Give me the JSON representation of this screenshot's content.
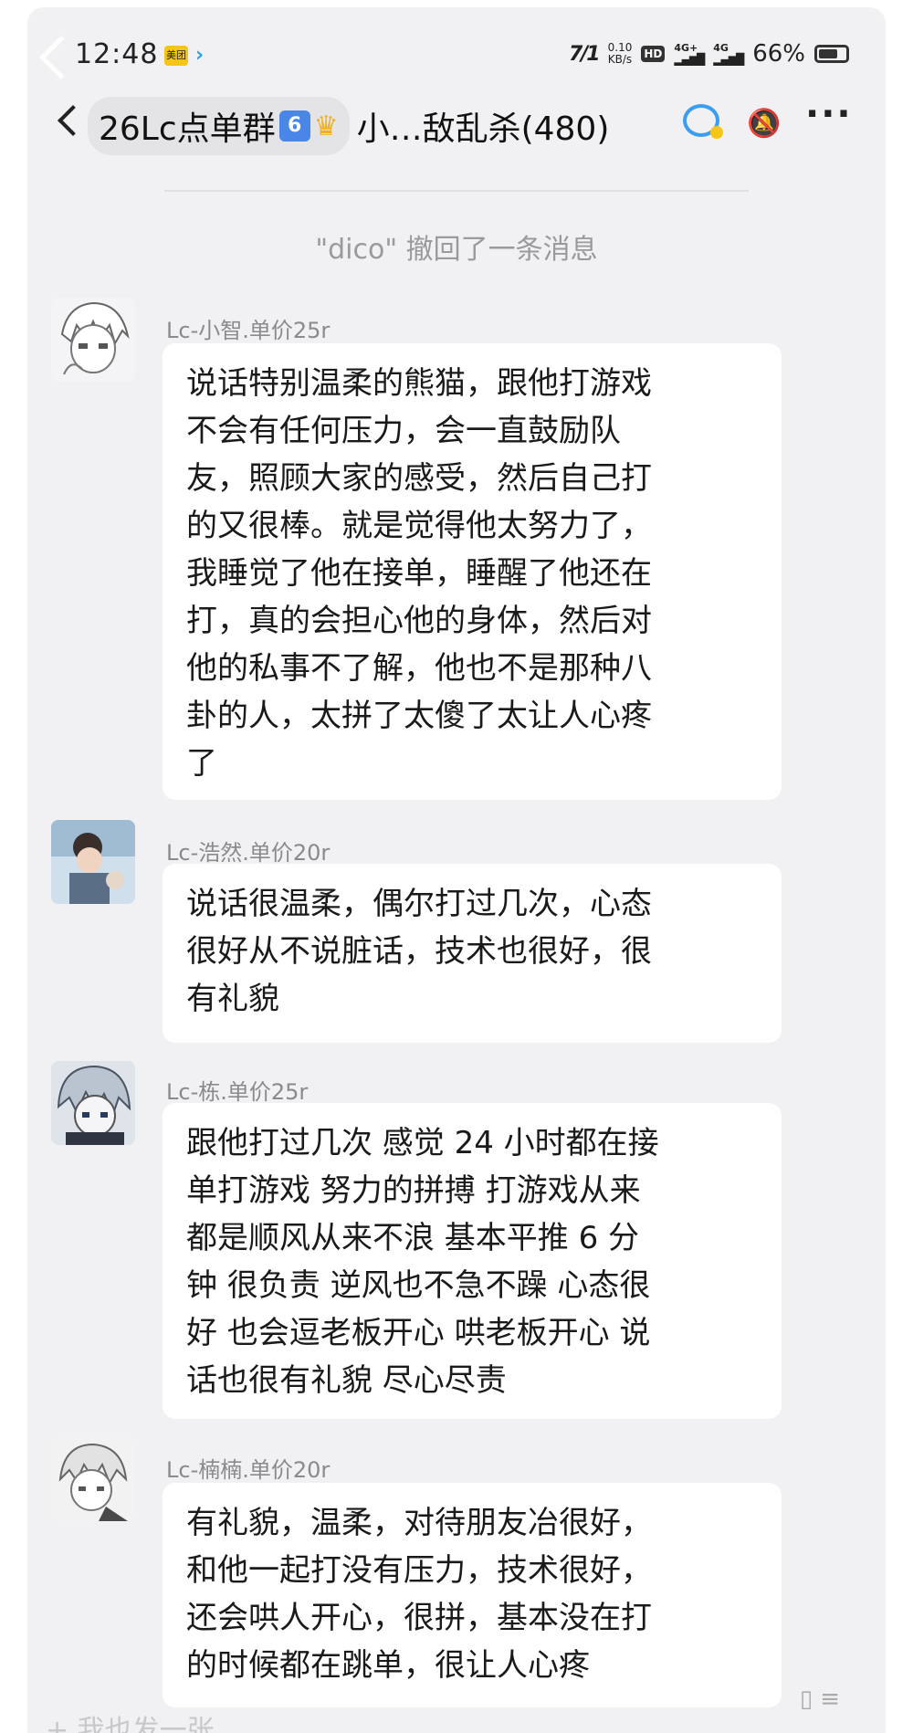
{
  "status_bar": {
    "time": "12:48",
    "app1_label": "美团",
    "network": "7/1",
    "speed_value": "0.10",
    "speed_unit": "KB/s",
    "hd_label": "HD",
    "signal1": "4G+",
    "signal2": "4G",
    "battery": "66%"
  },
  "header": {
    "group_name": "26Lc点单群",
    "group_badge": "6",
    "group_rest": "小…敌乱杀(480)"
  },
  "recall_notice": "\"dico\" 撤回了一条消息",
  "messages": [
    {
      "sender": "Lc-小智.单价25r",
      "lines": [
        "说话特别温柔的熊猫，跟他打游戏",
        "不会有任何压力，会一直鼓励队",
        "友，照顾大家的感受，然后自己打",
        "的又很棒。就是觉得他太努力了，",
        "我睡觉了他在接单，睡醒了他还在",
        "打，真的会担心他的身体，然后对",
        "他的私事不了解，他也不是那种八",
        "卦的人，太拼了太傻了太让人心疼",
        "了"
      ]
    },
    {
      "sender": "Lc-浩然.单价20r",
      "lines": [
        "说话很温柔，偶尔打过几次，心态",
        "很好从不说脏话，技术也很好，很",
        "有礼貌"
      ]
    },
    {
      "sender": "Lc-栋.单价25r",
      "lines": [
        "跟他打过几次 感觉 24 小时都在接",
        "单打游戏 努力的拼搏 打游戏从来",
        "都是顺风从来不浪 基本平推 6 分",
        "钟 很负责 逆风也不急不躁 心态很",
        "好 也会逗老板开心 哄老板开心 说",
        "话也很有礼貌 尽心尽责"
      ]
    },
    {
      "sender": "Lc-楠楠.单价20r",
      "lines": [
        "有礼貌，温柔，对待朋友冶很好，",
        "和他一起打没有压力，技术很好，",
        "还会哄人开心，很拼，基本没在打",
        "的时候都在跳单，很让人心疼"
      ]
    }
  ],
  "overlay_text": "+ 我也发一张"
}
